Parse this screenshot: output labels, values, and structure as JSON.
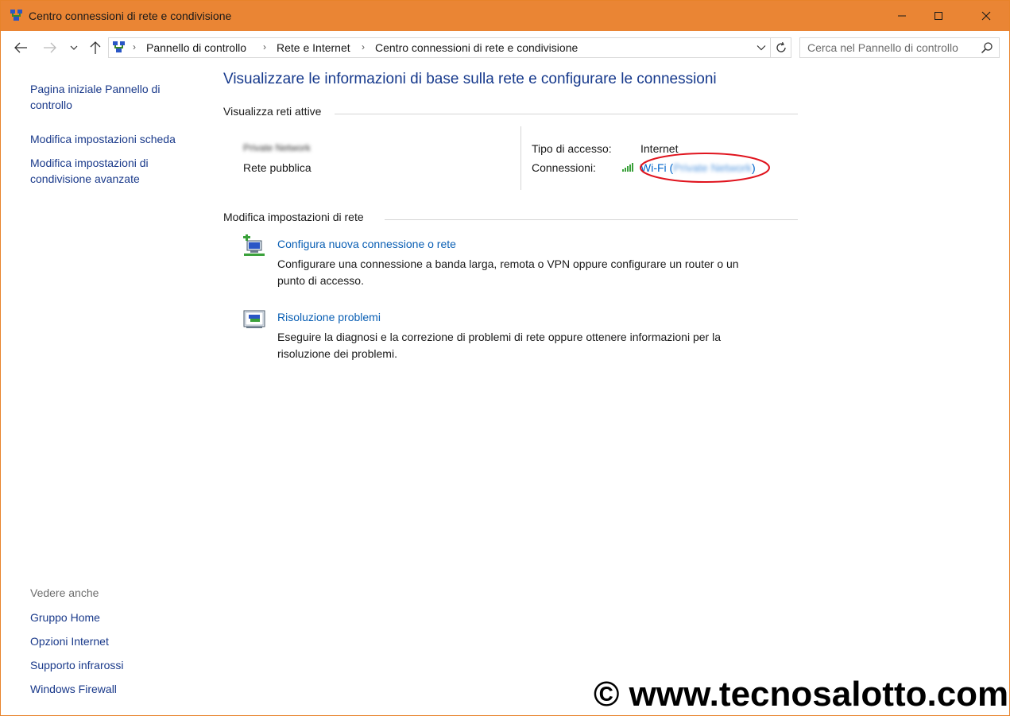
{
  "window": {
    "title": "Centro connessioni di rete e condivisione"
  },
  "nav": {
    "breadcrumbs": [
      "Pannello di controllo",
      "Rete e Internet",
      "Centro connessioni di rete e condivisione"
    ],
    "search_placeholder": "Cerca nel Pannello di controllo"
  },
  "sidebar": {
    "links": [
      {
        "line1": "Pagina iniziale Pannello di",
        "line2": "controllo"
      },
      {
        "line1": "Modifica impostazioni scheda",
        "line2": ""
      },
      {
        "line1": "Modifica impostazioni di",
        "line2": "condivisione avanzate"
      }
    ],
    "see_also_label": "Vedere anche",
    "see_also": [
      "Gruppo Home",
      "Opzioni Internet",
      "Supporto infrarossi",
      "Windows Firewall"
    ]
  },
  "main": {
    "title": "Visualizzare le informazioni di base sulla rete e configurare le connessioni",
    "active_networks_header": "Visualizza reti attive",
    "network": {
      "name": "Private Network",
      "category": "Rete pubblica",
      "access_type_label": "Tipo di accesso:",
      "access_type_value": "Internet",
      "connections_label": "Connessioni:",
      "connection_prefix": "Wi-Fi (",
      "connection_name": "Private Network",
      "connection_suffix": ")"
    },
    "change_settings_header": "Modifica impostazioni di rete",
    "tasks": [
      {
        "title": "Configura nuova connessione o rete",
        "desc_line1": "Configurare una connessione a banda larga, remota o VPN oppure configurare un router o un",
        "desc_line2": "punto di accesso."
      },
      {
        "title": "Risoluzione problemi",
        "desc_line1": "Eseguire la diagnosi e la correzione di problemi di rete oppure ottenere informazioni per la",
        "desc_line2": "risoluzione dei problemi."
      }
    ]
  },
  "watermark": "© www.tecnosalotto.com",
  "colors": {
    "titlebar": "#ea8534",
    "link": "#0a5fb4",
    "heading": "#16398c",
    "highlight": "#e0141e"
  }
}
